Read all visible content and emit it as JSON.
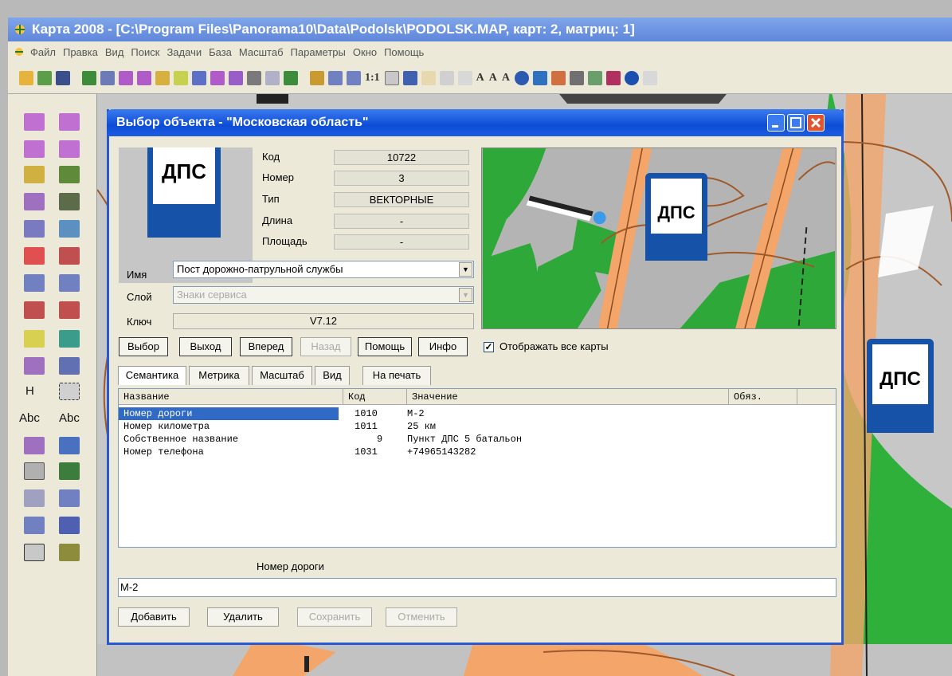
{
  "app": {
    "title": "Карта 2008 - [C:\\Program Files\\Panorama10\\Data\\Podolsk\\PODOLSK.MAP, карт: 2, матриц: 1]",
    "menu": [
      "Файл",
      "Правка",
      "Вид",
      "Поиск",
      "Задачи",
      "База",
      "Масштаб",
      "Параметры",
      "Окно",
      "Помощь"
    ],
    "toolbar_scale_label": "1:1",
    "toolbar_text_buttons": [
      "A",
      "A",
      "A"
    ],
    "left_toolbar_letters": [
      "H",
      "Abc",
      "Abc"
    ]
  },
  "dialog": {
    "title": "Выбор объекта - \"Московская область\"",
    "sign_text": "ДПС",
    "properties": {
      "code_label": "Код",
      "code_value": "10722",
      "number_label": "Номер",
      "number_value": "3",
      "type_label": "Тип",
      "type_value": "ВЕКТОРНЫЕ",
      "length_label": "Длина",
      "length_value": "-",
      "area_label": "Площадь",
      "area_value": "-"
    },
    "name_label": "Имя",
    "name_value": "Пост дорожно-патрульной службы",
    "layer_label": "Слой",
    "layer_value": "Знаки сервиса",
    "key_label": "Ключ",
    "key_value": "V7.12",
    "buttons": {
      "select": "Выбор",
      "exit": "Выход",
      "forward": "Вперед",
      "back": "Назад",
      "help": "Помощь",
      "info": "Инфо"
    },
    "show_all_maps_label": "Отображать все карты",
    "show_all_maps_checked": true,
    "tabs": [
      "Семантика",
      "Метрика",
      "Масштаб",
      "Вид",
      "На печать"
    ],
    "table": {
      "headers": [
        "Название",
        "Код",
        "Значение",
        "Обяз."
      ],
      "rows": [
        {
          "name": "Номер дороги",
          "code": "1010",
          "value": "М-2"
        },
        {
          "name": "Номер километра",
          "code": "1011",
          "value": "25 км"
        },
        {
          "name": "Собственное название",
          "code": "9",
          "value": "Пункт ДПС 5 батальон"
        },
        {
          "name": "Номер телефона",
          "code": "1031",
          "value": "+74965143282"
        }
      ]
    },
    "selected_field_label": "Номер дороги",
    "selected_field_value": "М-2",
    "bottom_buttons": {
      "add": "Добавить",
      "delete": "Удалить",
      "save": "Сохранить",
      "cancel": "Отменить"
    }
  },
  "map": {
    "sign_text": "ДПС"
  }
}
